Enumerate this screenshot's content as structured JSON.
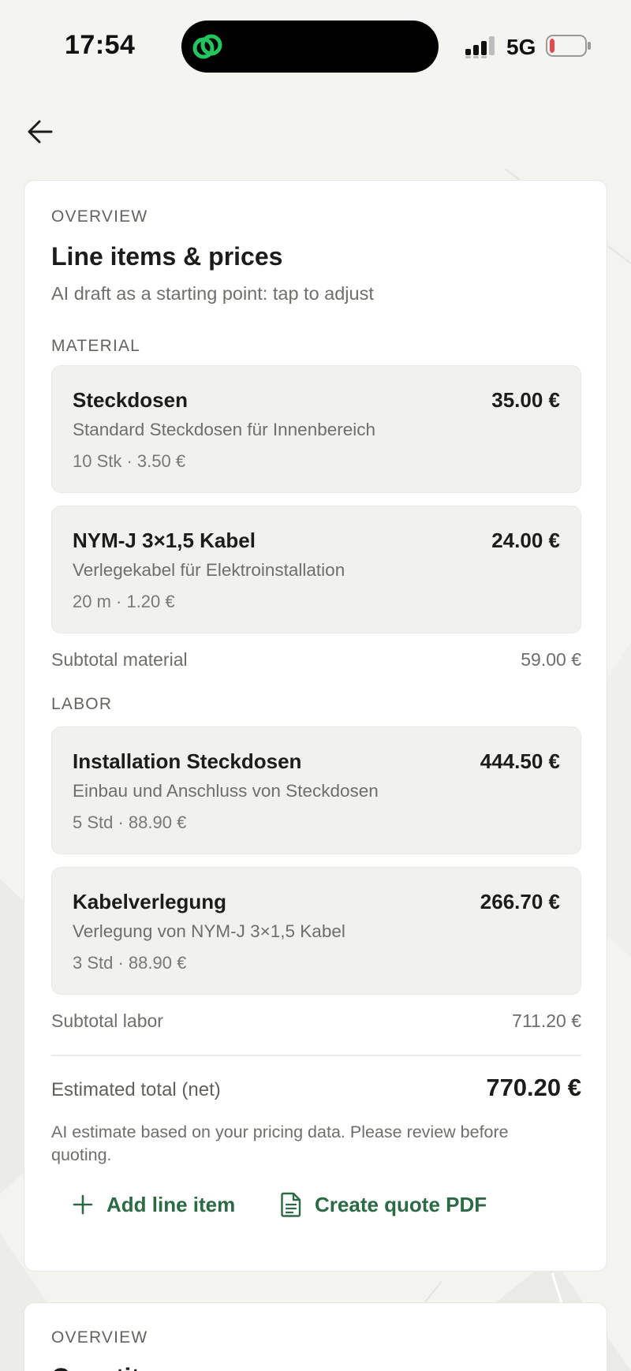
{
  "status_bar": {
    "time": "17:54",
    "network": "5G",
    "battery_level": 0.12,
    "battery_color": "#e5484d",
    "island_logo_color": "#22c55e"
  },
  "header": {
    "back_icon": "arrow-left-icon"
  },
  "quote_card": {
    "eyebrow": "OVERVIEW",
    "title": "Line items & prices",
    "subtitle": "AI draft as a starting point: tap to adjust",
    "material": {
      "label": "MATERIAL",
      "items": [
        {
          "name": "Steckdosen",
          "price": "35.00 €",
          "description": "Standard Steckdosen für Innenbereich",
          "meta": "10 Stk · 3.50 €"
        },
        {
          "name": "NYM-J 3×1,5 Kabel",
          "price": "24.00 €",
          "description": "Verlegekabel für Elektroinstallation",
          "meta": "20 m · 1.20 €"
        }
      ],
      "subtotal_label": "Subtotal material",
      "subtotal_value": "59.00 €"
    },
    "labor": {
      "label": "LABOR",
      "items": [
        {
          "name": "Installation Steckdosen",
          "price": "444.50 €",
          "description": "Einbau und Anschluss von Steckdosen",
          "meta": "5 Std · 88.90 €"
        },
        {
          "name": "Kabelverlegung",
          "price": "266.70 €",
          "description": "Verlegung von NYM-J 3×1,5 Kabel",
          "meta": "3 Std · 88.90 €"
        }
      ],
      "subtotal_label": "Subtotal labor",
      "subtotal_value": "711.20 €"
    },
    "total_label": "Estimated total (net)",
    "total_value": "770.20 €",
    "disclaimer": "AI estimate based on your pricing data. Please review before quoting.",
    "actions": {
      "add_label": "Add line item",
      "pdf_label": "Create quote PDF",
      "accent_color": "#2c6a45"
    }
  },
  "second_card": {
    "eyebrow": "OVERVIEW",
    "title": "Quantit"
  }
}
